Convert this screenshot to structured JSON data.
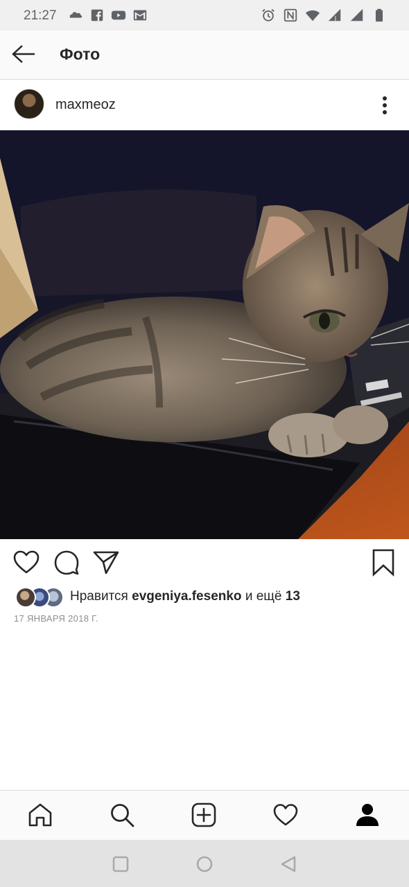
{
  "status_bar": {
    "time": "21:27",
    "left_icons": [
      "cloud-icon",
      "facebook-icon",
      "youtube-icon",
      "gmail-icon"
    ],
    "right_icons": [
      "alarm-icon",
      "nfc-icon",
      "wifi-icon",
      "signal-icon",
      "signal-icon",
      "battery-icon"
    ]
  },
  "header": {
    "title": "Фото",
    "back_icon": "arrow-left-icon"
  },
  "post": {
    "username": "maxmeoz",
    "image_description": "photo of a tabby kitten lying on a black laptop",
    "likes": {
      "prefix": "Нравится",
      "user": "evgeniya.fesenko",
      "conjunction": "и ещё",
      "count": "13"
    },
    "date": "17 ЯНВАРЯ 2018 Г."
  },
  "actions": [
    "heart-icon",
    "comment-icon",
    "share-icon",
    "bookmark-icon"
  ],
  "bottom_nav": [
    "home-icon",
    "search-icon",
    "add-post-icon",
    "heart-icon",
    "profile-icon"
  ],
  "system_nav": [
    "recents-icon",
    "home-circle-icon",
    "back-triangle-icon"
  ],
  "colors": {
    "status_bar_bg": "#f0f0f0",
    "text_primary": "#262626",
    "text_secondary": "#8e8e8e",
    "divider": "#dbdbdb",
    "system_nav_bg": "#e3e3e3"
  }
}
